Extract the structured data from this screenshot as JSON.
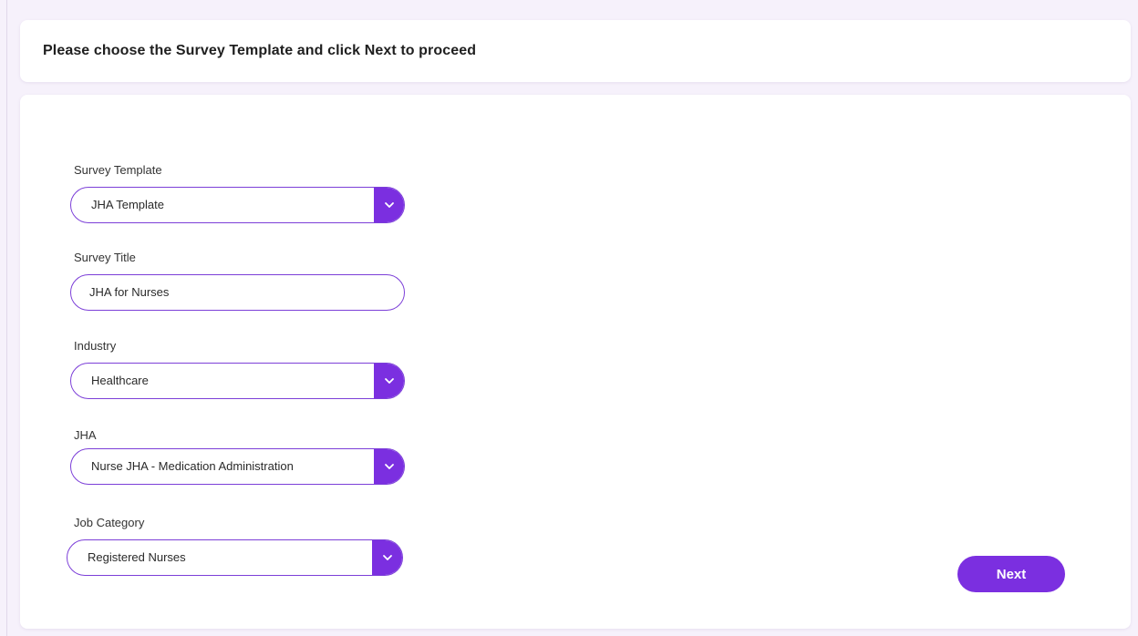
{
  "header": {
    "title": "Please choose the Survey Template and click Next to proceed"
  },
  "form": {
    "survey_template": {
      "label": "Survey Template",
      "value": "JHA Template"
    },
    "survey_title": {
      "label": "Survey Title",
      "value": "JHA for Nurses"
    },
    "industry": {
      "label": "Industry",
      "value": "Healthcare"
    },
    "jha": {
      "label": "JHA",
      "value": "Nurse JHA - Medication Administration"
    },
    "job_category": {
      "label": "Job Category",
      "value": "Registered Nurses"
    }
  },
  "actions": {
    "next_label": "Next"
  },
  "icons": {
    "dropdown": "chevron-down-icon"
  },
  "colors": {
    "accent": "#7b2fe0",
    "border": "#7c3fd8",
    "background": "#f6f1fb"
  }
}
